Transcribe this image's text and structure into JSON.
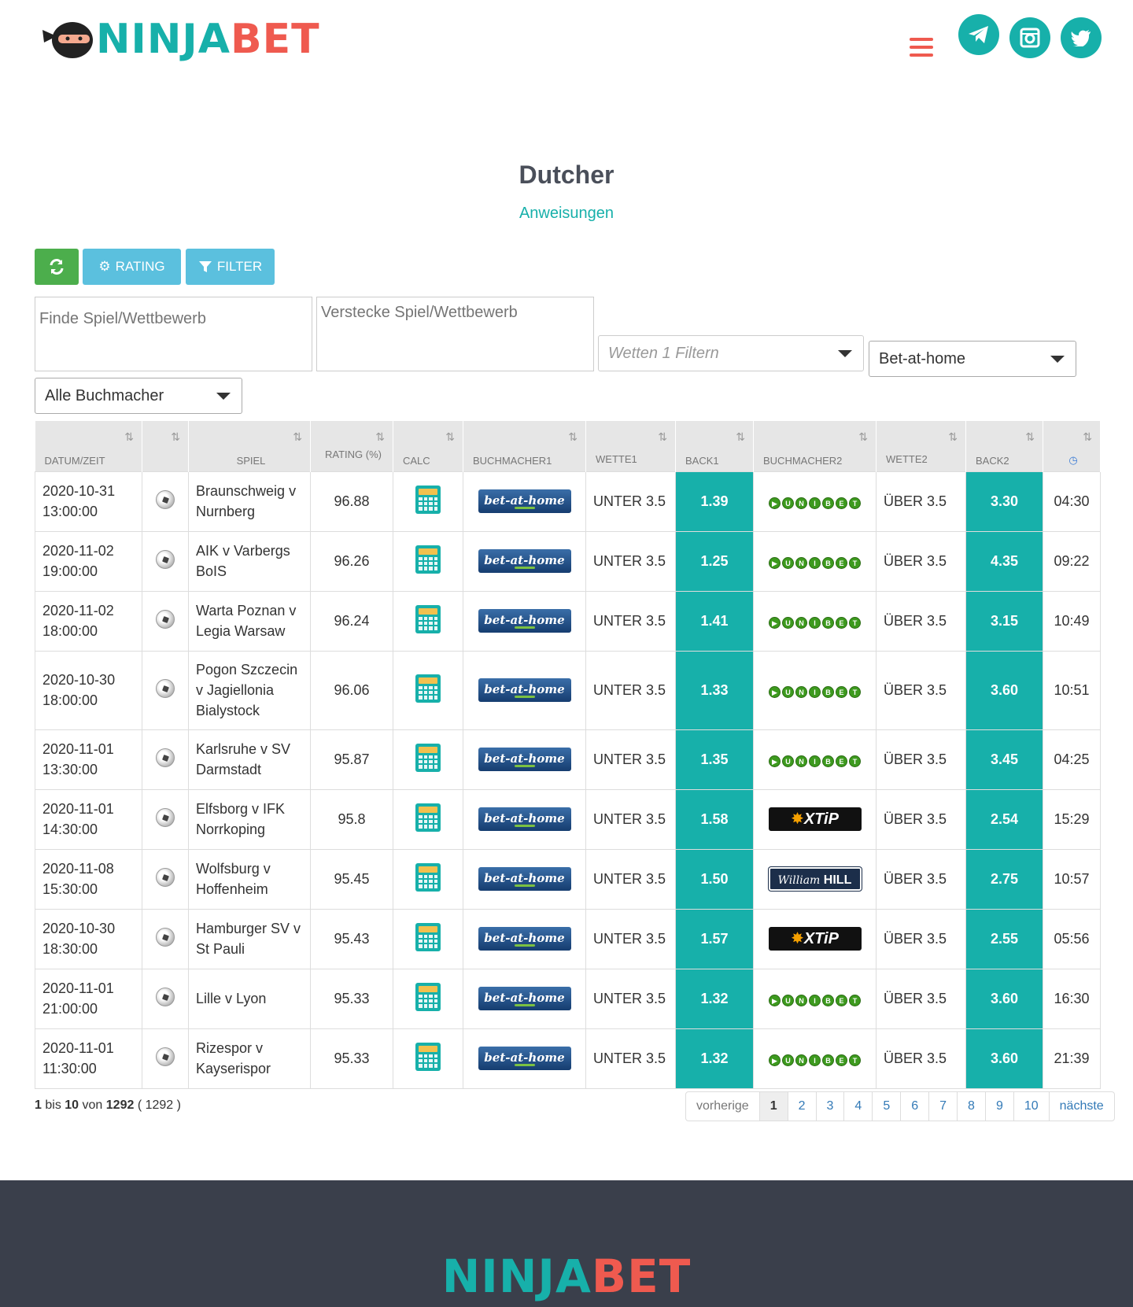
{
  "brand": {
    "part1": "NINJA",
    "part2": "BET"
  },
  "colors": {
    "teal": "#17b0aa",
    "red": "#ef5a4f",
    "green_btn": "#4cae4c",
    "blue_btn": "#5bc0de",
    "footer": "#3a3f4b"
  },
  "header": {
    "icons": [
      "hamburger-icon",
      "telegram-icon",
      "instagram-icon",
      "twitter-icon"
    ]
  },
  "page": {
    "title": "Dutcher",
    "link": "Anweisungen"
  },
  "toolbar": {
    "refresh_icon": "refresh-icon",
    "rating_label": "RATING",
    "filter_label": "FILTER"
  },
  "filters": {
    "search_placeholder": "Finde Spiel/Wettbewerb",
    "hide_placeholder": "Verstecke Spiel/Wettbewerb",
    "bet_filter_placeholder": "Wetten 1 Filtern",
    "bookmaker1_selected": "Bet-at-home",
    "bookmakers_selected": "Alle Buchmacher"
  },
  "table": {
    "headers": [
      "DATUM/ZEIT",
      "",
      "SPIEL",
      "RATING (%)",
      "CALC",
      "BUCHMACHER1",
      "WETTE1",
      "BACK1",
      "BUCHMACHER2",
      "WETTE2",
      "BACK2",
      ""
    ],
    "rows": [
      {
        "date": "2020-10-31",
        "time": "13:00:00",
        "game": "Braunschweig v Nurnberg",
        "rating": "96.88",
        "bk1": "bet-at-home",
        "bet1": "UNTER 3.5",
        "back1": "1.39",
        "bk2": "unibet",
        "bet2": "ÜBER 3.5",
        "back2": "3.30",
        "age": "04:30"
      },
      {
        "date": "2020-11-02",
        "time": "19:00:00",
        "game": "AIK v Varbergs BoIS",
        "rating": "96.26",
        "bk1": "bet-at-home",
        "bet1": "UNTER 3.5",
        "back1": "1.25",
        "bk2": "unibet",
        "bet2": "ÜBER 3.5",
        "back2": "4.35",
        "age": "09:22"
      },
      {
        "date": "2020-11-02",
        "time": "18:00:00",
        "game": "Warta Poznan v Legia Warsaw",
        "rating": "96.24",
        "bk1": "bet-at-home",
        "bet1": "UNTER 3.5",
        "back1": "1.41",
        "bk2": "unibet",
        "bet2": "ÜBER 3.5",
        "back2": "3.15",
        "age": "10:49"
      },
      {
        "date": "2020-10-30",
        "time": "18:00:00",
        "game": "Pogon Szczecin v Jagiellonia Bialystock",
        "rating": "96.06",
        "bk1": "bet-at-home",
        "bet1": "UNTER 3.5",
        "back1": "1.33",
        "bk2": "unibet",
        "bet2": "ÜBER 3.5",
        "back2": "3.60",
        "age": "10:51"
      },
      {
        "date": "2020-11-01",
        "time": "13:30:00",
        "game": "Karlsruhe v SV Darmstadt",
        "rating": "95.87",
        "bk1": "bet-at-home",
        "bet1": "UNTER 3.5",
        "back1": "1.35",
        "bk2": "unibet",
        "bet2": "ÜBER 3.5",
        "back2": "3.45",
        "age": "04:25"
      },
      {
        "date": "2020-11-01",
        "time": "14:30:00",
        "game": "Elfsborg v IFK Norrkoping",
        "rating": "95.8",
        "bk1": "bet-at-home",
        "bet1": "UNTER 3.5",
        "back1": "1.58",
        "bk2": "xtip",
        "bet2": "ÜBER 3.5",
        "back2": "2.54",
        "age": "15:29"
      },
      {
        "date": "2020-11-08",
        "time": "15:30:00",
        "game": "Wolfsburg v Hoffenheim",
        "rating": "95.45",
        "bk1": "bet-at-home",
        "bet1": "UNTER 3.5",
        "back1": "1.50",
        "bk2": "williamhill",
        "bet2": "ÜBER 3.5",
        "back2": "2.75",
        "age": "10:57"
      },
      {
        "date": "2020-10-30",
        "time": "18:30:00",
        "game": "Hamburger SV v St Pauli",
        "rating": "95.43",
        "bk1": "bet-at-home",
        "bet1": "UNTER 3.5",
        "back1": "1.57",
        "bk2": "xtip",
        "bet2": "ÜBER 3.5",
        "back2": "2.55",
        "age": "05:56"
      },
      {
        "date": "2020-11-01",
        "time": "21:00:00",
        "game": "Lille v Lyon",
        "rating": "95.33",
        "bk1": "bet-at-home",
        "bet1": "UNTER 3.5",
        "back1": "1.32",
        "bk2": "unibet",
        "bet2": "ÜBER 3.5",
        "back2": "3.60",
        "age": "16:30"
      },
      {
        "date": "2020-11-01",
        "time": "11:30:00",
        "game": "Rizespor v Kayserispor",
        "rating": "95.33",
        "bk1": "bet-at-home",
        "bet1": "UNTER 3.5",
        "back1": "1.32",
        "bk2": "unibet",
        "bet2": "ÜBER 3.5",
        "back2": "3.60",
        "age": "21:39"
      }
    ]
  },
  "logo_text": {
    "bah": "bet-at-home",
    "unibet": [
      "U",
      "N",
      "I",
      "B",
      "E",
      "T"
    ],
    "xtip": "XTiP",
    "wh_script": "William",
    "wh_bold": "HILL"
  },
  "info": {
    "from": "1",
    "bis": "bis",
    "to": "10",
    "von": "von",
    "total": "1292",
    "filtered": "( 1292 )"
  },
  "pager": {
    "prev": "vorherige",
    "pages": [
      "1",
      "2",
      "3",
      "4",
      "5",
      "6",
      "7",
      "8",
      "9",
      "10"
    ],
    "next": "nächste"
  }
}
